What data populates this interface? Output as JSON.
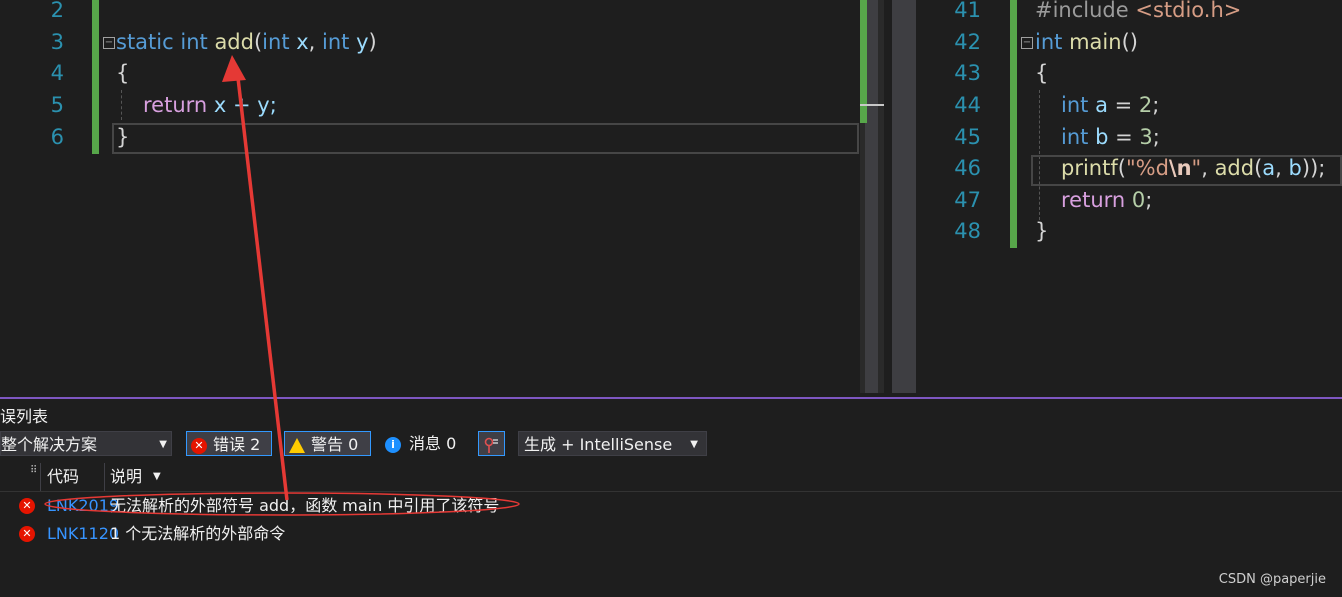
{
  "left_editor": {
    "line_numbers": [
      "2",
      "3",
      "4",
      "5",
      "6"
    ],
    "line3": {
      "kw_static": "static",
      "kw_int": "int",
      "fn": "add",
      "open": "(",
      "t1": "int",
      "p1": " x",
      "comma": ", ",
      "t2": "int",
      "p2": " y",
      "close": ")"
    },
    "line4": {
      "brace": "{"
    },
    "line5": {
      "ret": "return",
      "rest": " x + y;"
    },
    "line6": {
      "brace": "}"
    },
    "collapse_symbol": "⊟"
  },
  "right_editor": {
    "line_numbers": [
      "41",
      "42",
      "43",
      "44",
      "45",
      "46",
      "47",
      "48"
    ],
    "line41": {
      "pre": "#include ",
      "hdr": "<stdio.h>"
    },
    "line42": {
      "kw": "int",
      "fn": "main",
      "paren": "()"
    },
    "line43": {
      "brace": "{"
    },
    "line44": {
      "kw": "int",
      "var": " a",
      "eq": " = ",
      "num": "2",
      "semi": ";"
    },
    "line45": {
      "kw": "int",
      "var": " b",
      "eq": " = ",
      "num": "3",
      "semi": ";"
    },
    "line46": {
      "fn": "printf",
      "open": "(",
      "str1": "\"%d",
      "esc": "\\n",
      "str2": "\"",
      "comma": ", ",
      "fn2": "add",
      "open2": "(",
      "a": "a",
      "c2": ", ",
      "b": "b",
      "close": "));"
    },
    "line47": {
      "ret": "return",
      "sp": " ",
      "num": "0",
      "semi": ";"
    },
    "line48": {
      "brace": "}"
    },
    "collapse_symbol": "⊟"
  },
  "error_list": {
    "title": "误列表",
    "scope": "整个解决方案",
    "errors_label": "错误 2",
    "warnings_label": "警告 0",
    "messages_label": "消息 0",
    "build_source": "生成 + IntelliSense",
    "columns": {
      "code": "代码",
      "description": "说明"
    },
    "rows": [
      {
        "code": "LNK2019",
        "description": "无法解析的外部符号 add，函数 main 中引用了该符号"
      },
      {
        "code": "LNK1120",
        "description": "1 个无法解析的外部命令"
      }
    ]
  },
  "watermark": "CSDN @paperjie",
  "colors": {
    "accent_green": "#57a64a",
    "annotation_red": "#e53935",
    "error_red": "#e51400",
    "link_blue": "#3794ff"
  }
}
